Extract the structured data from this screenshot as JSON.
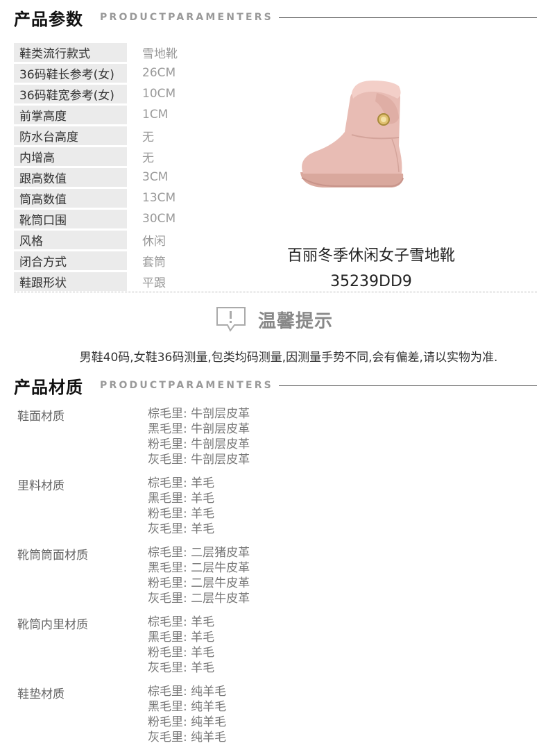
{
  "section1": {
    "title": "产品参数",
    "subtitle": "PRODUCTPARAMENTERS"
  },
  "params": [
    {
      "label": "鞋类流行款式",
      "value": "雪地靴"
    },
    {
      "label": "36码鞋长参考(女)",
      "value": "26CM"
    },
    {
      "label": "36码鞋宽参考(女)",
      "value": "10CM"
    },
    {
      "label": "前掌高度",
      "value": "1CM"
    },
    {
      "label": "防水台高度",
      "value": "无"
    },
    {
      "label": "内增高",
      "value": "无"
    },
    {
      "label": "跟高数值",
      "value": "3CM"
    },
    {
      "label": "筒高数值",
      "value": "13CM"
    },
    {
      "label": "靴筒口围",
      "value": "30CM"
    },
    {
      "label": "风格",
      "value": "休闲"
    },
    {
      "label": "闭合方式",
      "value": "套筒"
    },
    {
      "label": "鞋跟形状",
      "value": "平跟"
    }
  ],
  "product": {
    "name": "百丽冬季休闲女子雪地靴",
    "code": "35239DD9",
    "image_icon": "pink-snow-boot-image",
    "boot_color": "#e8bcb4"
  },
  "tip": {
    "icon": "exclamation-speech-bubble-icon",
    "title": "温馨提示",
    "text": "男鞋40码,女鞋36码测量,包类均码测量,因测量手势不同,会有偏差,请以实物为准."
  },
  "section2": {
    "title": "产品材质",
    "subtitle": "PRODUCTPARAMENTERS"
  },
  "materials": [
    {
      "label": "鞋面材质",
      "lines": [
        "棕毛里: 牛剖层皮革",
        "黑毛里: 牛剖层皮革",
        "粉毛里: 牛剖层皮革",
        "灰毛里: 牛剖层皮革"
      ]
    },
    {
      "label": "里料材质",
      "lines": [
        "棕毛里: 羊毛",
        "黑毛里: 羊毛",
        "粉毛里: 羊毛",
        "灰毛里: 羊毛"
      ]
    },
    {
      "label": "靴筒筒面材质",
      "lines": [
        "棕毛里: 二层猪皮革",
        "黑毛里: 二层牛皮革",
        "粉毛里: 二层牛皮革",
        "灰毛里: 二层牛皮革"
      ]
    },
    {
      "label": "靴筒内里材质",
      "lines": [
        "棕毛里: 羊毛",
        "黑毛里: 羊毛",
        "粉毛里: 羊毛",
        "灰毛里: 羊毛"
      ]
    },
    {
      "label": "鞋垫材质",
      "lines": [
        "棕毛里: 纯羊毛",
        "黑毛里: 纯羊毛",
        "粉毛里: 纯羊毛",
        "灰毛里: 纯羊毛"
      ]
    }
  ]
}
